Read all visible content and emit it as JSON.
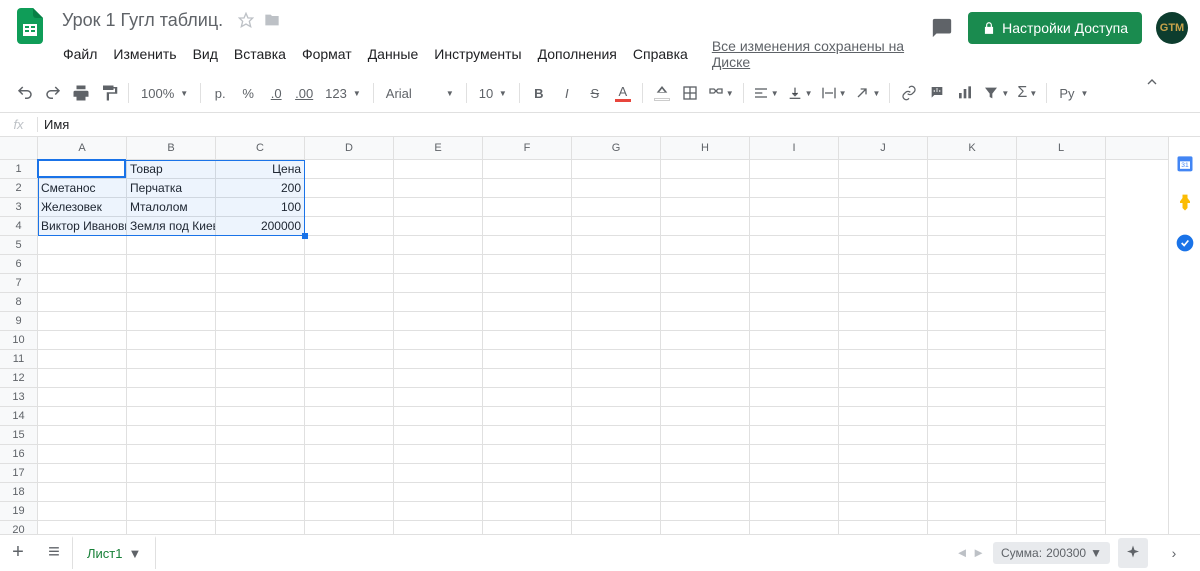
{
  "doc": {
    "title": "Урок 1 Гугл таблиц."
  },
  "menu": {
    "file": "Файл",
    "edit": "Изменить",
    "view": "Вид",
    "insert": "Вставка",
    "format": "Формат",
    "data": "Данные",
    "tools": "Инструменты",
    "addons": "Дополнения",
    "help": "Справка",
    "saved": "Все изменения сохранены на Диске"
  },
  "share": {
    "label": "Настройки Доступа"
  },
  "avatar": {
    "initials": "GTM"
  },
  "toolbar": {
    "zoom": "100%",
    "currency": "р.",
    "percent": "%",
    "dec_less": ".0",
    "dec_more": ".00",
    "num_format": "123",
    "font": "Arial",
    "size": "10",
    "lang": "Ру"
  },
  "formula": {
    "value": "Имя"
  },
  "columns": [
    "A",
    "B",
    "C",
    "D",
    "E",
    "F",
    "G",
    "H",
    "I",
    "J",
    "K",
    "L"
  ],
  "row_count": 22,
  "cells": {
    "A1": "Имя",
    "B1": "Товар",
    "C1": "Цена",
    "A2": "Сметанос",
    "B2": "Перчатка",
    "C2": "200",
    "A3": "Железовек",
    "B3": "Мталолом",
    "C3": "100",
    "A4": "Виктор Иванови",
    "B4": "Земля под Киев",
    "C4": "200000"
  },
  "sheet": {
    "name": "Лист1"
  },
  "status": {
    "sum_label": "Сумма:",
    "sum_value": "200300"
  }
}
